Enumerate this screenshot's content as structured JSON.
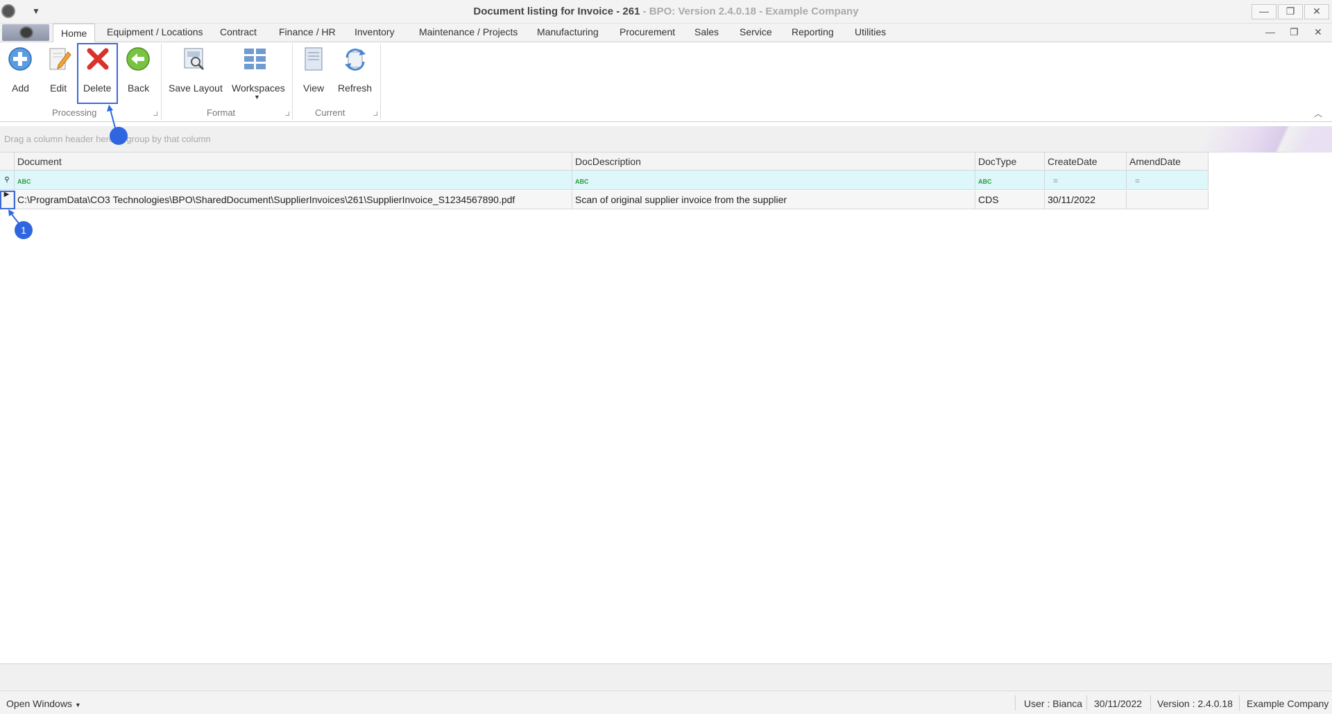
{
  "window": {
    "title_main": "Document listing for Invoice - 261",
    "title_sub": " - BPO: Version 2.4.0.18 - Example Company"
  },
  "tabs": [
    "Home",
    "Equipment / Locations",
    "Contract",
    "Finance / HR",
    "Inventory",
    "Maintenance / Projects",
    "Manufacturing",
    "Procurement",
    "Sales",
    "Service",
    "Reporting",
    "Utilities"
  ],
  "ribbon": {
    "buttons": {
      "add": "Add",
      "edit": "Edit",
      "delete": "Delete",
      "back": "Back",
      "save_layout": "Save Layout",
      "workspaces": "Workspaces",
      "view": "View",
      "refresh": "Refresh"
    },
    "groups": {
      "processing": "Processing",
      "format": "Format",
      "current": "Current"
    }
  },
  "group_panel_hint": "Drag a column header here to group by that column",
  "grid": {
    "columns": [
      "Document",
      "DocDescription",
      "DocType",
      "CreateDate",
      "AmendDate"
    ],
    "filter_abc": "ABC",
    "filter_eq": "=",
    "rows": [
      {
        "document": "C:\\ProgramData\\CO3 Technologies\\BPO\\SharedDocument\\SupplierInvoices\\261\\SupplierInvoice_S1234567890.pdf",
        "description": "Scan of original supplier invoice from the supplier",
        "doctype": "CDS",
        "createdate": "30/11/2022",
        "amenddate": ""
      }
    ]
  },
  "annotations": {
    "step1": "1"
  },
  "statusbar": {
    "open_windows": "Open Windows",
    "user": "User : Bianca",
    "date": "30/11/2022",
    "version": "Version : 2.4.0.18",
    "company": "Example Company"
  },
  "colors": {
    "accent": "#2f66e0",
    "filter_row": "#ddf7fb"
  }
}
